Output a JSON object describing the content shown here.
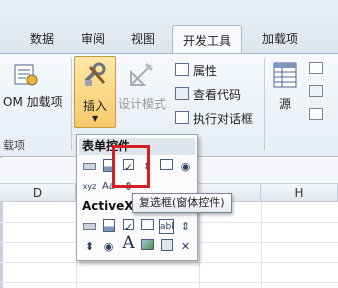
{
  "tabs": [
    {
      "label": "数据",
      "active": false
    },
    {
      "label": "审阅",
      "active": false
    },
    {
      "label": "视图",
      "active": false
    },
    {
      "label": "开发工具",
      "active": true
    },
    {
      "label": "加载项",
      "active": false
    }
  ],
  "ribbon": {
    "com_addin_label": "OM 加载项",
    "group_left_label": "载项",
    "insert_label": "插入",
    "design_mode_label": "设计模式",
    "properties_label": "属性",
    "view_code_label": "查看代码",
    "run_dialog_label": "执行对话框",
    "source_label": "源"
  },
  "columns": [
    "D",
    "H"
  ],
  "dropdown": {
    "form_controls_title": "表单控件",
    "activex_title": "ActiveX"
  },
  "tooltip": "复选框(窗体控件)",
  "colors": {
    "accent": "#f7c96b",
    "highlight_border": "#d61e1e"
  }
}
